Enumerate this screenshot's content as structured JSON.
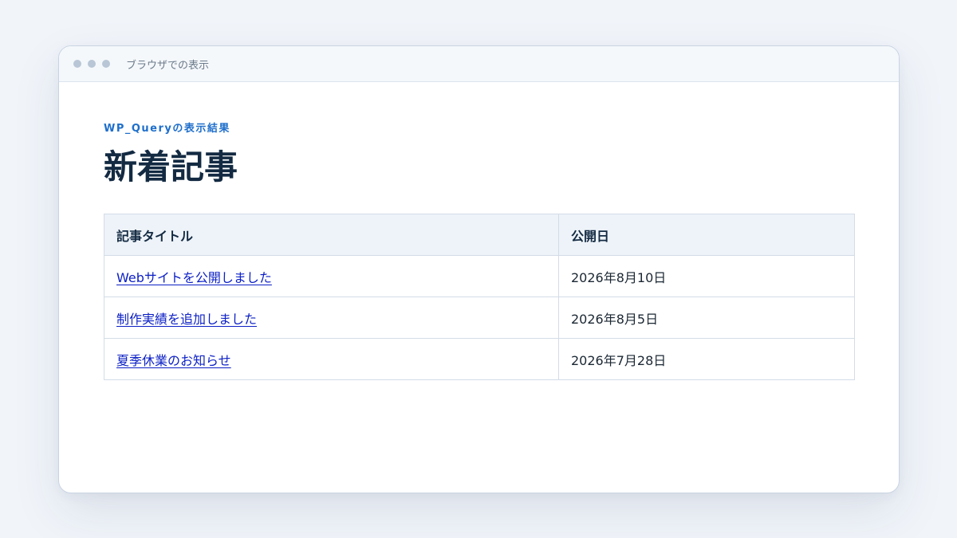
{
  "window": {
    "title": "ブラウザでの表示"
  },
  "page": {
    "eyebrow": "WP_Queryの表示結果",
    "title": "新着記事"
  },
  "table": {
    "headers": [
      "記事タイトル",
      "公開日"
    ],
    "rows": [
      {
        "title": "Webサイトを公開しました",
        "date": "2026年8月10日"
      },
      {
        "title": "制作実績を追加しました",
        "date": "2026年8月5日"
      },
      {
        "title": "夏季休業のお知らせ",
        "date": "2026年7月28日"
      }
    ]
  },
  "colors": {
    "accent": "#1f6fcb",
    "link": "#0b1fc4",
    "heading": "#132a42"
  }
}
